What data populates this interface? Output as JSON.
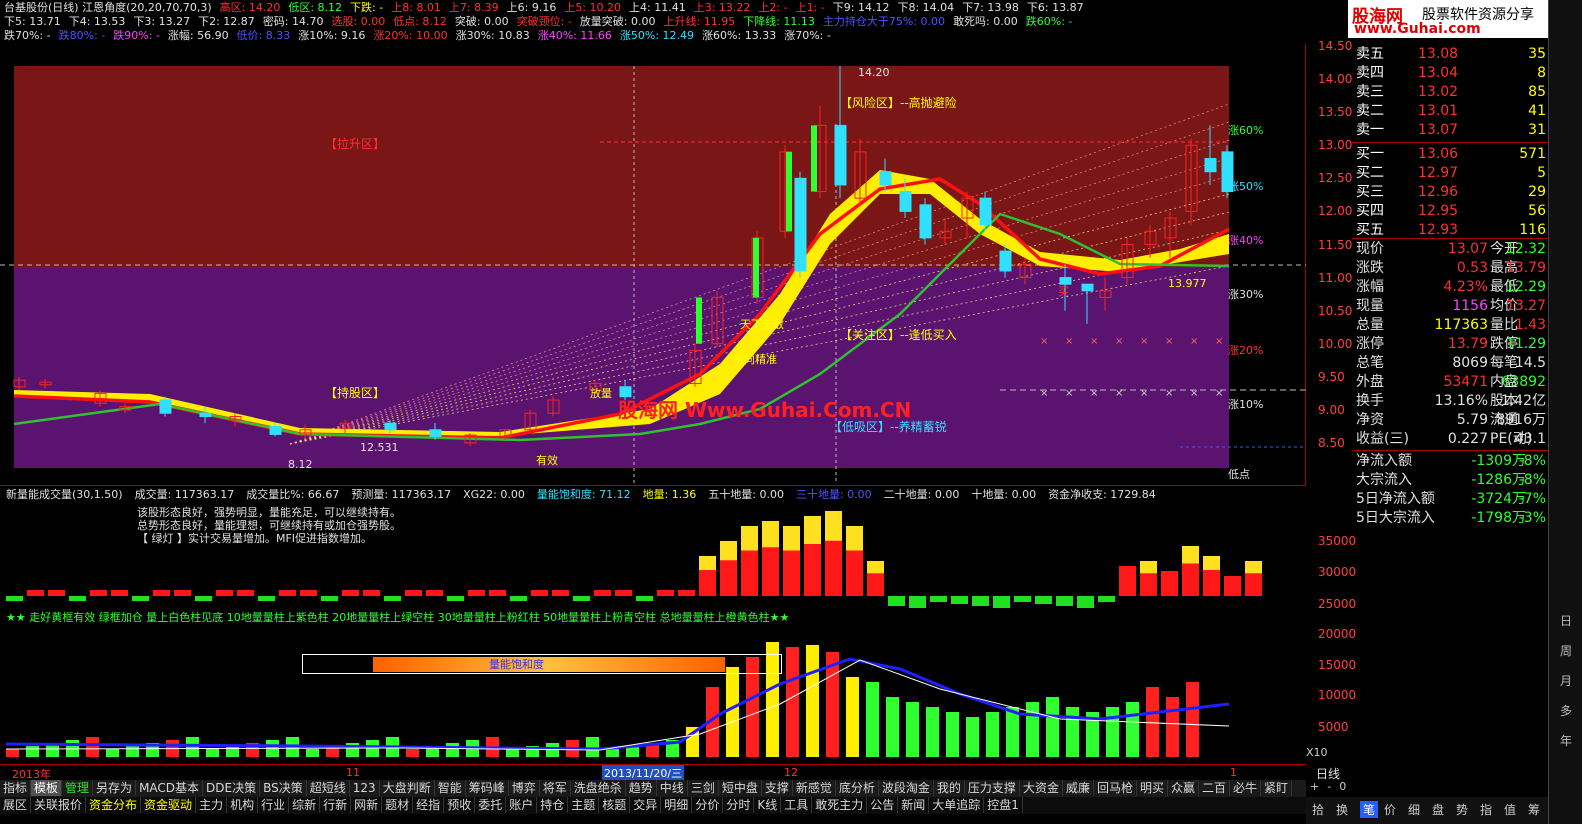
{
  "header": {
    "line1": [
      {
        "t": "台基股份(日线) 江恩角度(20,20,70,70,3)",
        "c": "w"
      },
      {
        "t": "高区: 14.20",
        "c": "r"
      },
      {
        "t": "低区: 8.12",
        "c": "g"
      },
      {
        "t": "下跌: -",
        "c": "y"
      },
      {
        "t": "上8: 8.01",
        "c": "r"
      },
      {
        "t": "上7: 8.39",
        "c": "r"
      },
      {
        "t": "上6: 9.16",
        "c": "w"
      },
      {
        "t": "上5: 10.20",
        "c": "r"
      },
      {
        "t": "上4: 11.41",
        "c": "w"
      },
      {
        "t": "上3: 13.22",
        "c": "r"
      },
      {
        "t": "上2: -",
        "c": "r"
      },
      {
        "t": "上1: -",
        "c": "r"
      },
      {
        "t": "下9: 14.12",
        "c": "w"
      },
      {
        "t": "下8: 14.04",
        "c": "w"
      },
      {
        "t": "下7: 13.98",
        "c": "w"
      },
      {
        "t": "下6: 13.87",
        "c": "w"
      }
    ],
    "line2": [
      {
        "t": "下5: 13.71",
        "c": "w"
      },
      {
        "t": "下4: 13.53",
        "c": "w"
      },
      {
        "t": "下3: 13.27",
        "c": "w"
      },
      {
        "t": "下2: 12.87",
        "c": "w"
      },
      {
        "t": "密码: 14.70",
        "c": "w"
      },
      {
        "t": "选股: 0.00",
        "c": "r"
      },
      {
        "t": "低点: 8.12",
        "c": "r"
      },
      {
        "t": "突破: 0.00",
        "c": "w"
      },
      {
        "t": "突破颈位: -",
        "c": "r"
      },
      {
        "t": "放量突破: 0.00",
        "c": "w"
      },
      {
        "t": "上升线: 11.95",
        "c": "r"
      },
      {
        "t": "下降线: 11.13",
        "c": "g"
      },
      {
        "t": "主力持仓大于75%: 0.00",
        "c": "b"
      },
      {
        "t": "敢死吗: 0.00",
        "c": "w"
      },
      {
        "t": "跌60%: -",
        "c": "g"
      }
    ],
    "line3": [
      {
        "t": "跌70%: -",
        "c": "w"
      },
      {
        "t": "跌80%: -",
        "c": "b"
      },
      {
        "t": "跌90%: -",
        "c": "m"
      },
      {
        "t": "涨幅: 56.90",
        "c": "w"
      },
      {
        "t": "低价: 8.33",
        "c": "b"
      },
      {
        "t": "涨10%: 9.16",
        "c": "w"
      },
      {
        "t": "涨20%: 10.00",
        "c": "r"
      },
      {
        "t": "涨30%: 10.83",
        "c": "w"
      },
      {
        "t": "涨40%: 11.66",
        "c": "m"
      },
      {
        "t": "涨50%: 12.49",
        "c": "c"
      },
      {
        "t": "涨60%: 13.33",
        "c": "w"
      },
      {
        "t": "涨70%: -",
        "c": "w"
      }
    ]
  },
  "zones": {
    "pull": "【拉升区】",
    "hold": "【持股区】",
    "risk": "【风险区】--高抛避险",
    "focus": "【关注区】--逢低买入",
    "low": "【低吸区】--养精蓄锐"
  },
  "pct_labels": [
    "涨60%",
    "涨50%",
    "涨40%",
    "涨30%",
    "涨20%",
    "涨10%",
    "低点"
  ],
  "y_axis": [
    "14.50",
    "14.00",
    "13.50",
    "13.00",
    "12.50",
    "12.00",
    "11.50",
    "11.00",
    "10.50",
    "10.00",
    "9.50",
    "9.00",
    "8.50"
  ],
  "watermark": "股海网 Www.Guhai.Com.CN",
  "annotations": {
    "fangliang": "放量",
    "tianxia": "天下无敌",
    "pingxiang": "平向精准",
    "youxiao": "有效",
    "maimai": "买",
    "low_price": "8.12",
    "low_price2": "12.531",
    "high_price": "14.20",
    "right_price": "13.977"
  },
  "ind1": {
    "header": [
      {
        "t": "新量能成交量(30,1.50)",
        "c": "w"
      },
      {
        "t": "成交量: 117363.17",
        "c": "w"
      },
      {
        "t": "成交量比%: 66.67",
        "c": "w"
      },
      {
        "t": "预测量: 117363.17",
        "c": "w"
      },
      {
        "t": "XG22: 0.00",
        "c": "w"
      },
      {
        "t": "量能饱和度: 71.12",
        "c": "c"
      },
      {
        "t": "地量: 1.36",
        "c": "y"
      },
      {
        "t": "五十地量: 0.00",
        "c": "w"
      },
      {
        "t": "三十地量: 0.00",
        "c": "b"
      },
      {
        "t": "二十地量: 0.00",
        "c": "w"
      },
      {
        "t": "十地量: 0.00",
        "c": "w"
      },
      {
        "t": "资金净收支: 1729.84",
        "c": "w"
      }
    ],
    "notes": [
      "该股形态良好，强势明显，量能充足，可以继续持有。",
      "总势形态良好，量能理想，可继续持有或加仓强势股。",
      "【 绿灯 】实计交易量增加。MFI促进指数增加。"
    ],
    "legend": "★★ 走好黄框有效 绿框加仓 量上白色柱见底 10地量量柱上紫色柱 20地量量柱上绿空柱 30地量量柱上粉红柱 50地量量柱上粉青空柱 总地量量柱上橙黄色柱★★",
    "y": [
      "35000",
      "30000",
      "25000"
    ]
  },
  "ind2": {
    "y": [
      "20000",
      "15000",
      "10000",
      "5000"
    ],
    "bar_label": "量能饱和度",
    "x10": "X10"
  },
  "timeline": {
    "y2013": "2013年",
    "m11": "11",
    "date": "2013/11/20/三",
    "m12": "12",
    "m1": "1",
    "period": "日线"
  },
  "quote": {
    "sell": [
      {
        "k": "卖五",
        "p": "13.08",
        "v": "35"
      },
      {
        "k": "卖四",
        "p": "13.04",
        "v": "8"
      },
      {
        "k": "卖三",
        "p": "13.02",
        "v": "85"
      },
      {
        "k": "卖二",
        "p": "13.01",
        "v": "41"
      },
      {
        "k": "卖一",
        "p": "13.07",
        "v": "31"
      }
    ],
    "buy": [
      {
        "k": "买一",
        "p": "13.06",
        "v": "571"
      },
      {
        "k": "买二",
        "p": "12.97",
        "v": "5"
      },
      {
        "k": "买三",
        "p": "12.96",
        "v": "29"
      },
      {
        "k": "买四",
        "p": "12.95",
        "v": "56"
      },
      {
        "k": "买五",
        "p": "12.93",
        "v": "116"
      }
    ],
    "stats": [
      {
        "a": "现价",
        "av": "13.07",
        "ac": "r",
        "b": "今开",
        "bv": "12.32",
        "bc": "g"
      },
      {
        "a": "涨跌",
        "av": "0.53",
        "ac": "r",
        "b": "最高",
        "bv": "13.79",
        "bc": "r"
      },
      {
        "a": "涨幅",
        "av": "4.23%",
        "ac": "r",
        "b": "最低",
        "bv": "12.29",
        "bc": "g"
      },
      {
        "a": "现量",
        "av": "1156",
        "ac": "m",
        "b": "均价",
        "bv": "13.27",
        "bc": "r"
      },
      {
        "a": "总量",
        "av": "117363",
        "ac": "y",
        "b": "量比",
        "bv": "1.43",
        "bc": "r"
      },
      {
        "a": "涨停",
        "av": "13.79",
        "ac": "r",
        "b": "跌停",
        "bv": "11.29",
        "bc": "g"
      },
      {
        "a": "总笔",
        "av": "8069",
        "ac": "w",
        "b": "每笔",
        "bv": "14.5",
        "bc": "w"
      },
      {
        "a": "外盘",
        "av": "53471",
        "ac": "r",
        "b": "内盘",
        "bv": "63892",
        "bc": "g"
      },
      {
        "a": "换手",
        "av": "13.16%",
        "ac": "w",
        "b": "股本",
        "bv": "1.42亿",
        "bc": "w"
      },
      {
        "a": "净资",
        "av": "5.79",
        "ac": "w",
        "b": "流通",
        "bv": "8916万",
        "bc": "w"
      },
      {
        "a": "收益(三)",
        "av": "0.227",
        "ac": "w",
        "b": "PE(动)",
        "bv": "43.1",
        "bc": "w"
      }
    ],
    "flows": [
      {
        "k": "净流入额",
        "v": "-1309万",
        "p": "-8%"
      },
      {
        "k": "大宗流入",
        "v": "-1286万",
        "p": "-8%"
      },
      {
        "k": "5日净流入额",
        "v": "-3724万",
        "p": "-7%"
      },
      {
        "k": "5日大宗流入",
        "v": "-1798万",
        "p": "-3%"
      }
    ]
  },
  "brand": {
    "name": "股海网",
    "slogan": "股票软件资源分享",
    "url": "www.Guhai.com"
  },
  "toolbar1": [
    "指标",
    "模板",
    "管理",
    "另存为",
    "MACD基本",
    "DDE决策",
    "BS决策",
    "超短线",
    "123",
    "大盘判断",
    "智能",
    "筹码峰",
    "博弈",
    "将军",
    "洗盘绝杀",
    "趋势",
    "中线",
    "三剑",
    "短中盘",
    "支撑",
    "新感觉",
    "底分析",
    "波段淘金",
    "我的",
    "压力支撑",
    "大资金",
    "威廉",
    "回马枪",
    "明买",
    "众赢",
    "二百",
    "必牛",
    "紧盯"
  ],
  "toolbar2": [
    "展区",
    "关联报价",
    "资金分布",
    "资金驱动",
    "主力",
    "机构",
    "行业",
    "综新",
    "行新",
    "网新",
    "题材",
    "经指",
    "预收",
    "委托",
    "账户",
    "持仓",
    "主题",
    "核题",
    "交异",
    "明细",
    "分价",
    "分时",
    "K线",
    "工具",
    "敢死主力",
    "公告",
    "新闻",
    "大单追踪",
    "控盘1"
  ],
  "right_tabs": [
    "拾",
    "换",
    "笔",
    "价",
    "细",
    "盘",
    "势",
    "指",
    "值",
    "筹"
  ],
  "side_tabs": [
    "日",
    "周",
    "月",
    "多",
    "年"
  ],
  "nav_mini": [
    "+",
    "-",
    "0"
  ]
}
